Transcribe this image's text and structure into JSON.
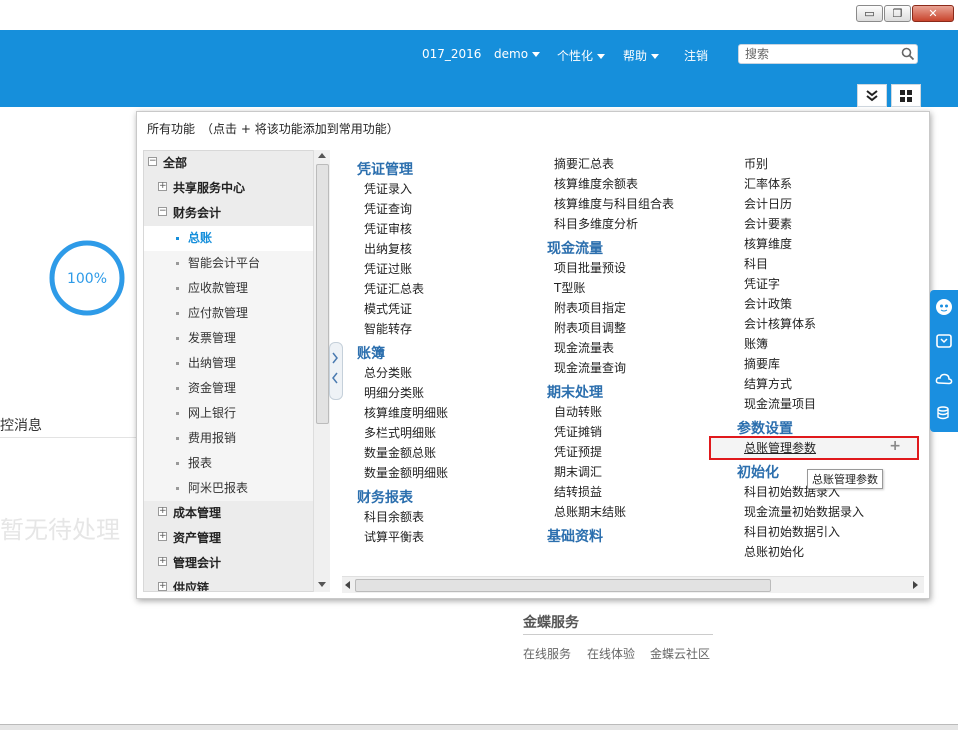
{
  "header": {
    "account": "017_2016",
    "user": "demo",
    "personalize": "个性化",
    "help": "帮助",
    "logout": "注销",
    "search_placeholder": "搜索"
  },
  "main": {
    "progress_text": "100%",
    "progress_value": 100,
    "control_message": "控消息",
    "ghost_text": "暂无待处理"
  },
  "panel": {
    "title": "所有功能",
    "hint": "（点击 + 将该功能添加到常用功能）",
    "tree": [
      {
        "label": "全部",
        "type": "minus",
        "level": 0,
        "bold": true
      },
      {
        "label": "共享服务中心",
        "type": "plus",
        "level": 1,
        "bold": true
      },
      {
        "label": "财务会计",
        "type": "minus",
        "level": 1,
        "bold": true
      },
      {
        "label": "总账",
        "type": "dot",
        "level": 2,
        "selected": true
      },
      {
        "label": "智能会计平台",
        "type": "dot",
        "level": 2
      },
      {
        "label": "应收款管理",
        "type": "dot",
        "level": 2
      },
      {
        "label": "应付款管理",
        "type": "dot",
        "level": 2
      },
      {
        "label": "发票管理",
        "type": "dot",
        "level": 2
      },
      {
        "label": "出纳管理",
        "type": "dot",
        "level": 2
      },
      {
        "label": "资金管理",
        "type": "dot",
        "level": 2
      },
      {
        "label": "网上银行",
        "type": "dot",
        "level": 2
      },
      {
        "label": "费用报销",
        "type": "dot",
        "level": 2
      },
      {
        "label": "报表",
        "type": "dot",
        "level": 2
      },
      {
        "label": "阿米巴报表",
        "type": "dot",
        "level": 2
      },
      {
        "label": "成本管理",
        "type": "plus",
        "level": 1,
        "bold": true
      },
      {
        "label": "资产管理",
        "type": "plus",
        "level": 1,
        "bold": true
      },
      {
        "label": "管理会计",
        "type": "plus",
        "level": 1,
        "bold": true
      },
      {
        "label": "供应链",
        "type": "plus",
        "level": 1,
        "bold": true
      }
    ],
    "col1": [
      {
        "kind": "hdr",
        "label": "凭证管理"
      },
      {
        "kind": "lnk",
        "label": "凭证录入"
      },
      {
        "kind": "lnk",
        "label": "凭证查询"
      },
      {
        "kind": "lnk",
        "label": "凭证审核"
      },
      {
        "kind": "lnk",
        "label": "出纳复核"
      },
      {
        "kind": "lnk",
        "label": "凭证过账"
      },
      {
        "kind": "lnk",
        "label": "凭证汇总表"
      },
      {
        "kind": "lnk",
        "label": "模式凭证"
      },
      {
        "kind": "lnk",
        "label": "智能转存"
      },
      {
        "kind": "hdr",
        "label": "账簿"
      },
      {
        "kind": "lnk",
        "label": "总分类账"
      },
      {
        "kind": "lnk",
        "label": "明细分类账"
      },
      {
        "kind": "lnk",
        "label": "核算维度明细账"
      },
      {
        "kind": "lnk",
        "label": "多栏式明细账"
      },
      {
        "kind": "lnk",
        "label": "数量金额总账"
      },
      {
        "kind": "lnk",
        "label": "数量金额明细账"
      },
      {
        "kind": "hdr",
        "label": "财务报表"
      },
      {
        "kind": "lnk",
        "label": "科目余额表"
      },
      {
        "kind": "lnk",
        "label": "试算平衡表"
      }
    ],
    "col2": [
      {
        "kind": "lnk",
        "label": "摘要汇总表"
      },
      {
        "kind": "lnk",
        "label": "核算维度余额表"
      },
      {
        "kind": "lnk",
        "label": "核算维度与科目组合表"
      },
      {
        "kind": "lnk",
        "label": "科目多维度分析"
      },
      {
        "kind": "hdr",
        "label": "现金流量"
      },
      {
        "kind": "lnk",
        "label": "项目批量预设"
      },
      {
        "kind": "lnk",
        "label": "T型账"
      },
      {
        "kind": "lnk",
        "label": "附表项目指定"
      },
      {
        "kind": "lnk",
        "label": "附表项目调整"
      },
      {
        "kind": "lnk",
        "label": "现金流量表"
      },
      {
        "kind": "lnk",
        "label": "现金流量查询"
      },
      {
        "kind": "hdr",
        "label": "期末处理"
      },
      {
        "kind": "lnk",
        "label": "自动转账"
      },
      {
        "kind": "lnk",
        "label": "凭证摊销"
      },
      {
        "kind": "lnk",
        "label": "凭证预提"
      },
      {
        "kind": "lnk",
        "label": "期末调汇"
      },
      {
        "kind": "lnk",
        "label": "结转损益"
      },
      {
        "kind": "lnk",
        "label": "总账期末结账"
      },
      {
        "kind": "hdr",
        "label": "基础资料"
      }
    ],
    "col3": [
      {
        "kind": "lnk",
        "label": "币别"
      },
      {
        "kind": "lnk",
        "label": "汇率体系"
      },
      {
        "kind": "lnk",
        "label": "会计日历"
      },
      {
        "kind": "lnk",
        "label": "会计要素"
      },
      {
        "kind": "lnk",
        "label": "核算维度"
      },
      {
        "kind": "lnk",
        "label": "科目"
      },
      {
        "kind": "lnk",
        "label": "凭证字"
      },
      {
        "kind": "lnk",
        "label": "会计政策"
      },
      {
        "kind": "lnk",
        "label": "会计核算体系"
      },
      {
        "kind": "lnk",
        "label": "账簿"
      },
      {
        "kind": "lnk",
        "label": "摘要库"
      },
      {
        "kind": "lnk",
        "label": "结算方式"
      },
      {
        "kind": "lnk",
        "label": "现金流量项目"
      },
      {
        "kind": "hdr",
        "label": "参数设置"
      },
      {
        "kind": "lnk",
        "label": "总账管理参数",
        "highlight": true
      },
      {
        "kind": "hdr",
        "label": "初始化"
      },
      {
        "kind": "lnk",
        "label": "科目初始数据录入"
      },
      {
        "kind": "lnk",
        "label": "现金流量初始数据录入"
      },
      {
        "kind": "lnk",
        "label": "科目初始数据引入"
      },
      {
        "kind": "lnk",
        "label": "总账初始化"
      }
    ],
    "tooltip": "总账管理参数",
    "add_symbol": "+"
  },
  "service": {
    "title": "金蝶服务",
    "links": [
      "在线服务",
      "在线体验",
      "金蝶云社区"
    ]
  },
  "colors": {
    "header_blue": "#168fdb",
    "section_blue": "#2c6fae",
    "highlight_red": "#e0191c",
    "progress_blue": "#2e9be8"
  }
}
